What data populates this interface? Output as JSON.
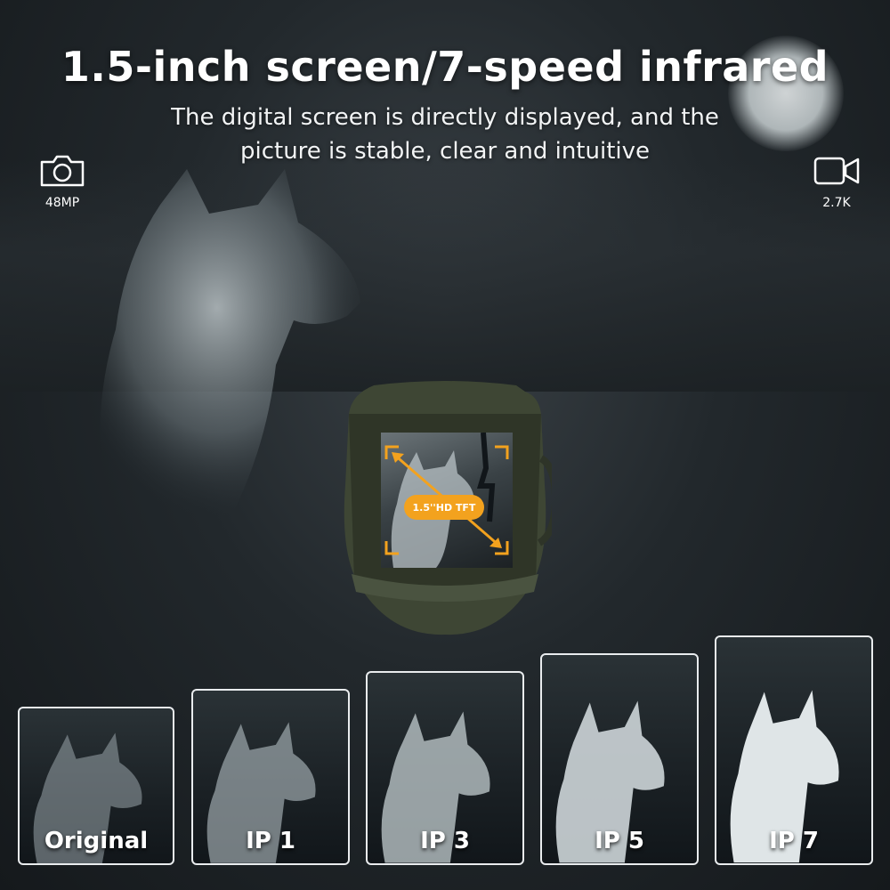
{
  "headline": "1.5-inch screen/7-speed infrared",
  "subtitle_line1": "The digital screen is directly displayed, and the",
  "subtitle_line2": "picture is stable, clear and intuitive",
  "specs": {
    "left": {
      "icon": "camera-icon",
      "label": "48MP"
    },
    "right": {
      "icon": "video-camera-icon",
      "label": "2.7K"
    }
  },
  "device": {
    "screen_badge": "1.5''HD TFT",
    "accent_color": "#f3a21e"
  },
  "comparisons": [
    {
      "label": "Original",
      "brightness": 0.55
    },
    {
      "label": "IP 1",
      "brightness": 0.65
    },
    {
      "label": "IP 3",
      "brightness": 0.78
    },
    {
      "label": "IP 5",
      "brightness": 0.9
    },
    {
      "label": "IP 7",
      "brightness": 1.0
    }
  ]
}
